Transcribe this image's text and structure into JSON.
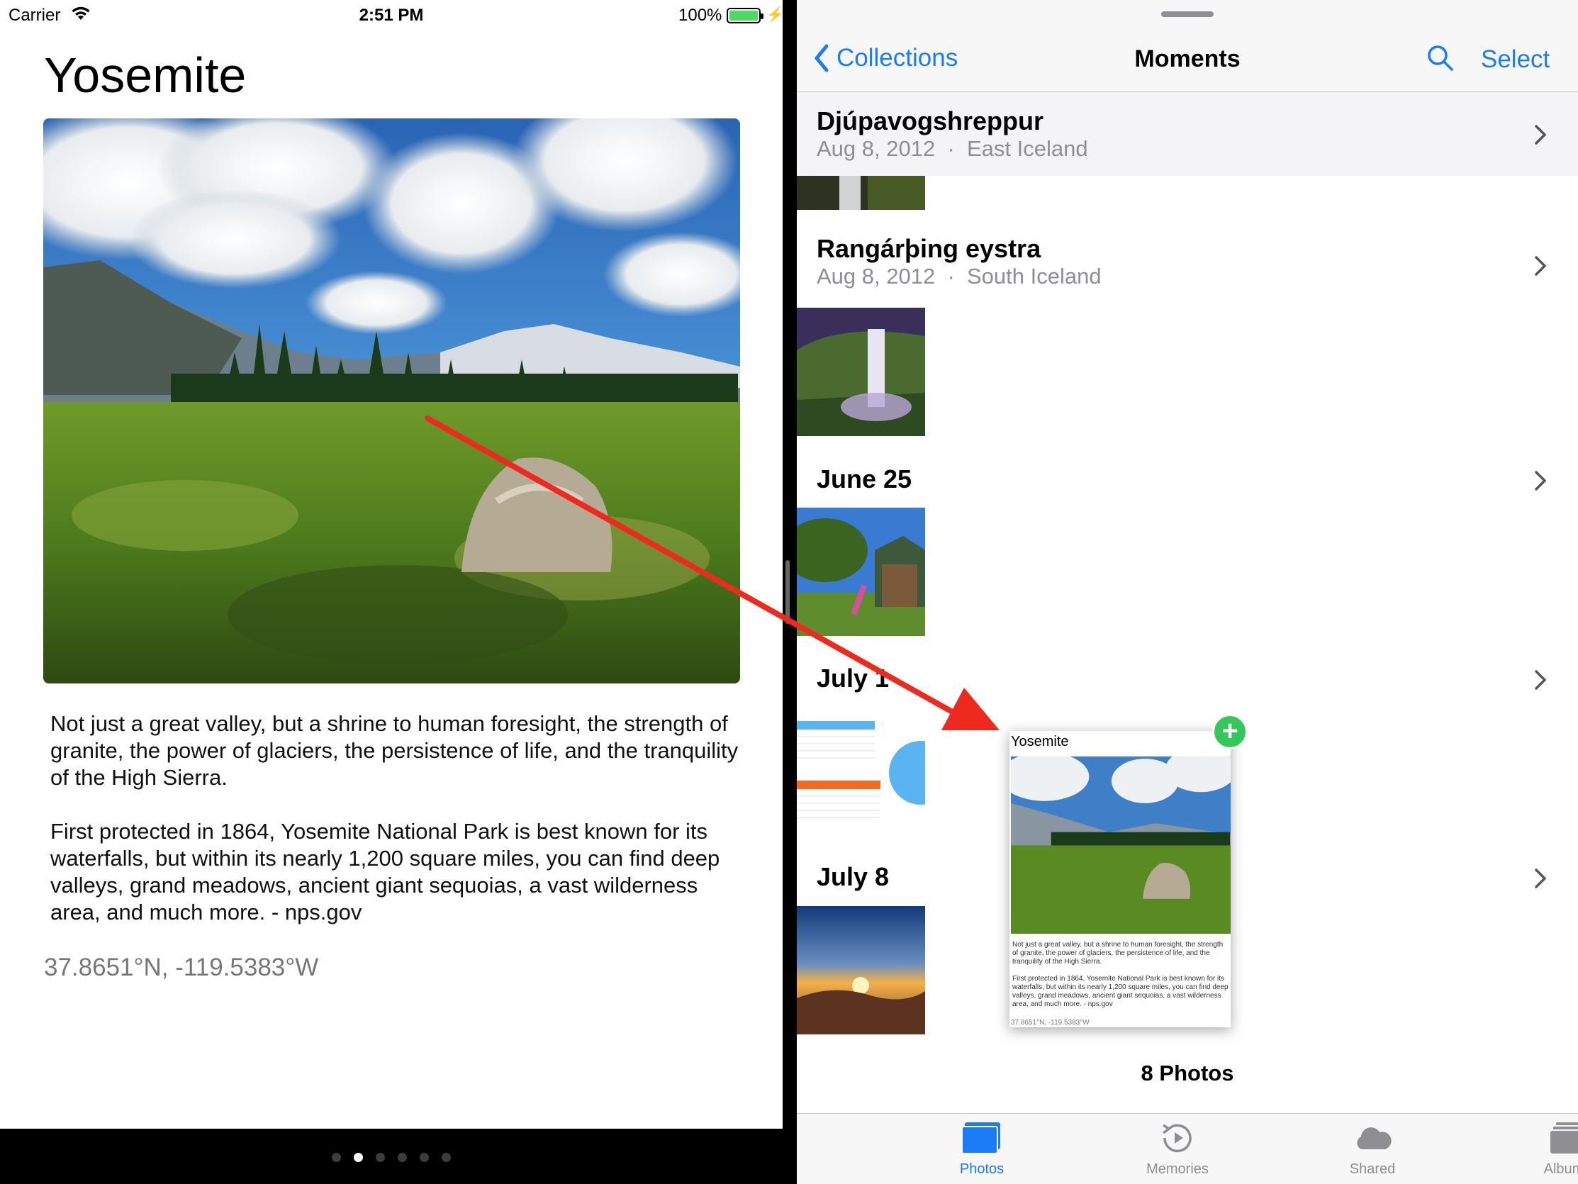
{
  "status_bar": {
    "carrier": "Carrier",
    "time": "2:51 PM",
    "battery": "100%"
  },
  "article": {
    "title": "Yosemite",
    "paragraph_1": "Not just a great valley, but a shrine to human foresight, the strength of granite, the power of glaciers, the persistence of life, and the tranquility of the High Sierra.",
    "paragraph_2": "First protected in 1864, Yosemite National Park is best known for its waterfalls, but within its nearly 1,200 square miles, you can find deep valleys, grand meadows, ancient giant sequoias, a vast wilderness area, and much more. - nps.gov",
    "coordinates": "37.8651°N, -119.5383°W",
    "page_count": 6,
    "current_page_index": 1
  },
  "photos": {
    "nav": {
      "back_label": "Collections",
      "title": "Moments",
      "select_label": "Select"
    },
    "moments": [
      {
        "title": "Djúpavogshreppur",
        "date": "Aug 8, 2012",
        "location": "East Iceland"
      },
      {
        "title": "Rangárþing eystra",
        "date": "Aug 8, 2012",
        "location": "South Iceland"
      },
      {
        "title": "June 25",
        "date": "",
        "location": ""
      },
      {
        "title": "July 1",
        "date": "",
        "location": ""
      },
      {
        "title": "July 8",
        "date": "",
        "location": ""
      }
    ],
    "separator": "·",
    "photo_count": "8 Photos",
    "drag_preview": {
      "title": "Yosemite",
      "text_1": "Not just a great valley, but a shrine to human foresight, the strength of granite, the power of glaciers, the persistence of life, and the tranquility of the High Sierra.",
      "text_2": "First protected in 1864, Yosemite National Park is best known for its waterfalls, but within its nearly 1,200 square miles, you can find deep valleys, grand meadows, ancient giant sequoias, a vast wilderness area, and much more. - nps.gov",
      "coordinates": "37.8651°N, -119.5383°W"
    },
    "tabs": [
      {
        "label": "Photos",
        "icon": "photos-icon",
        "active": true
      },
      {
        "label": "Memories",
        "icon": "memories-icon",
        "active": false
      },
      {
        "label": "Shared",
        "icon": "cloud-icon",
        "active": false
      },
      {
        "label": "Albums",
        "icon": "albums-icon",
        "active": false
      }
    ]
  },
  "colors": {
    "tint": "#1a7cf7",
    "add_badge": "#34c759",
    "battery": "#4cd964",
    "arrow": "#ee2a1e"
  }
}
